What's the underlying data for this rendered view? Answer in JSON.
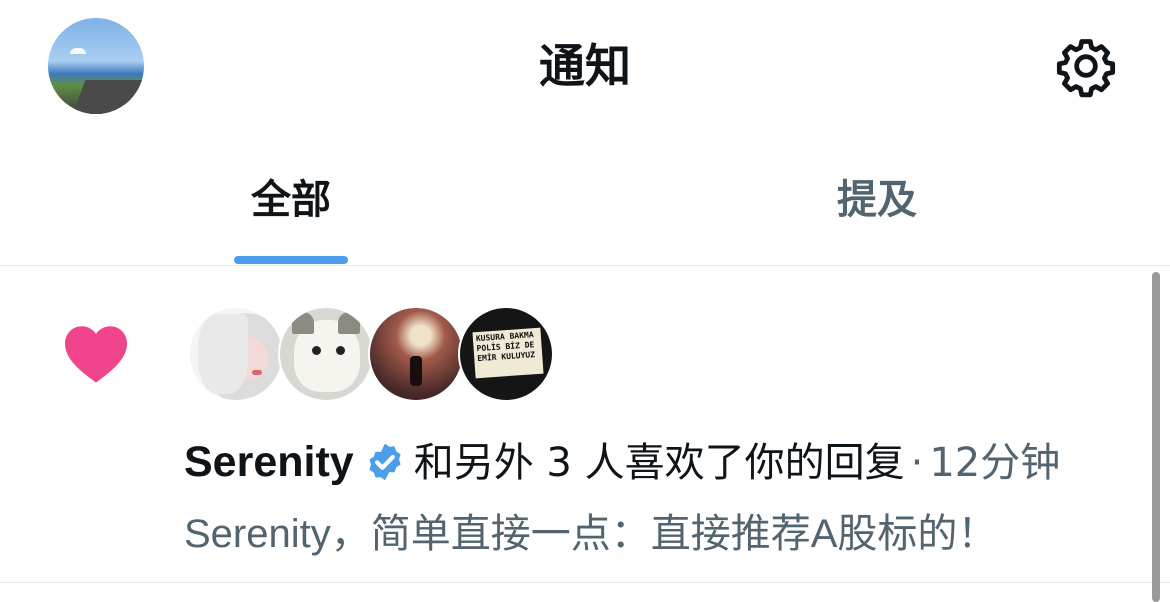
{
  "header": {
    "title": "通知",
    "avatar_icon": "user-avatar",
    "settings_icon": "gear-icon"
  },
  "tabs": [
    {
      "label": "全部",
      "active": true
    },
    {
      "label": "提及",
      "active": false
    }
  ],
  "notification": {
    "type_icon": "heart-icon",
    "type_color": "#f0458c",
    "user_name": "Serenity",
    "verified": true,
    "verified_color": "#4c9eeb",
    "action_text": "和另外 3 人喜欢了你的回复",
    "separator": "·",
    "time": "12分钟",
    "content": "Serenity，简单直接一点：直接推荐A股标的！",
    "avatar_sign_text": "KUSURA BAKMA POLİS BİZ DE EMİR KULUYUZ"
  },
  "colors": {
    "accent": "#4c9eeb",
    "text_primary": "#0f1419",
    "text_secondary": "#536471",
    "divider": "#e7e9ea"
  }
}
